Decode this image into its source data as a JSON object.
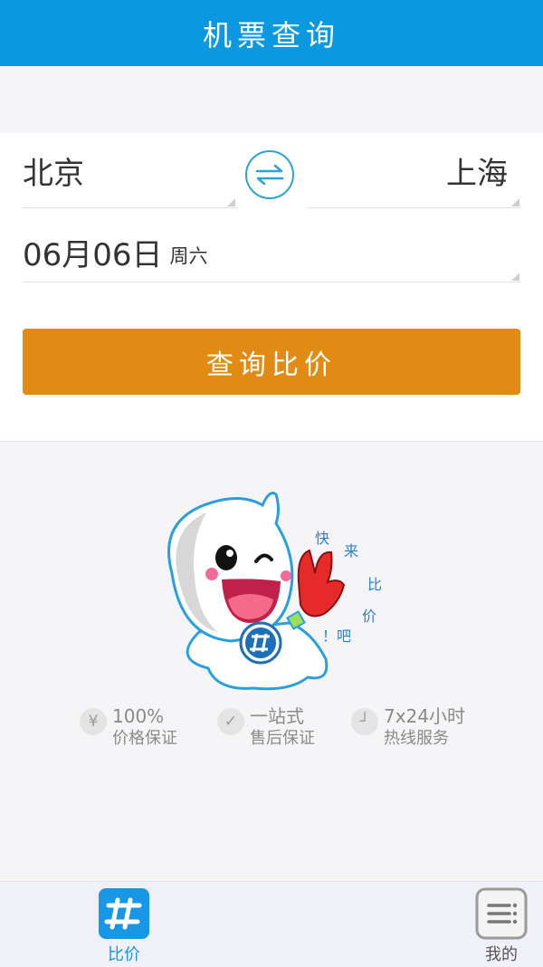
{
  "header": {
    "title": "机票查询"
  },
  "search": {
    "from_city": "北京",
    "to_city": "上海",
    "date": "06月06日",
    "weekday": "周六",
    "button_label": "查询比价"
  },
  "mascot": {
    "slogan_chars": [
      "快",
      "来",
      "比",
      "价",
      "！吧"
    ]
  },
  "features": [
    {
      "icon": "yuan-icon",
      "glyph": "¥",
      "title": "100%",
      "subtitle": "价格保证"
    },
    {
      "icon": "check-icon",
      "glyph": "✓",
      "title": "一站式",
      "subtitle": "售后保证"
    },
    {
      "icon": "clock-icon",
      "glyph": "┘",
      "title": "7x24小时",
      "subtitle": "热线服务"
    }
  ],
  "tabbar": {
    "items": [
      {
        "label": "比价",
        "active": true,
        "icon": "compare-logo-icon"
      },
      {
        "label": "我的",
        "active": false,
        "icon": "menu-list-icon"
      }
    ]
  },
  "colors": {
    "header_bg": "#0a98e0",
    "accent_orange": "#e28b14",
    "tab_active": "#1797e6",
    "swap_icon": "#2aa3d9"
  }
}
